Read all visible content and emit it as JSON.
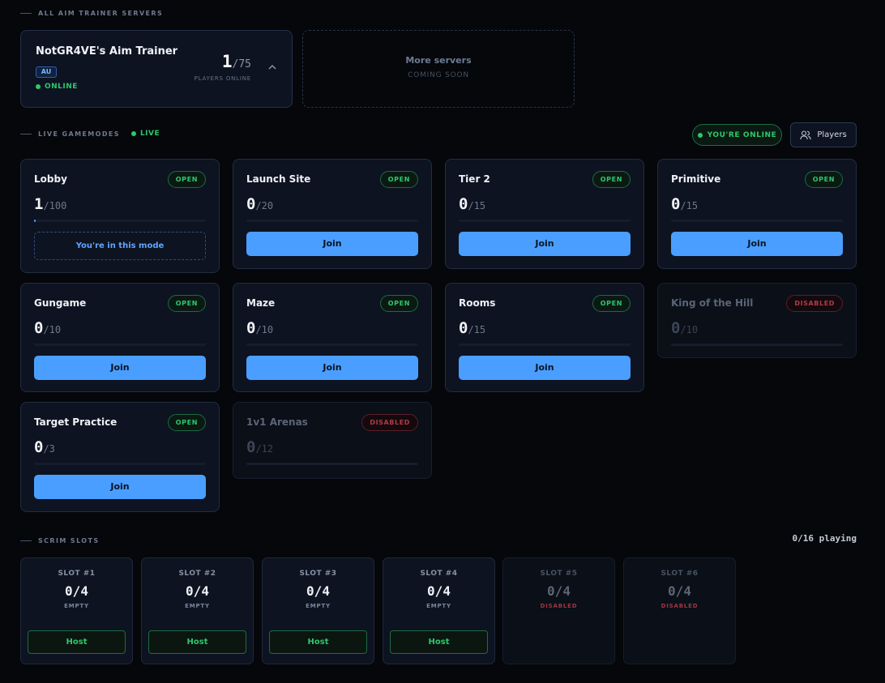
{
  "sections": {
    "servers_label": "ALL AIM TRAINER SERVERS",
    "gamemodes_label": "LIVE GAMEMODES",
    "live_tag": "LIVE",
    "scrim_label": "SCRIM SLOTS"
  },
  "server": {
    "name": "NotGR4VE's Aim Trainer",
    "region": "AU",
    "status": "ONLINE",
    "players": "1",
    "capacity": "/75",
    "players_label": "PLAYERS ONLINE"
  },
  "more_servers": {
    "title": "More servers",
    "subtitle": "COMING SOON"
  },
  "header_actions": {
    "online_status": "YOU'RE ONLINE",
    "players_button": "Players"
  },
  "modes": [
    {
      "name": "Lobby",
      "badge": "OPEN",
      "count": "1",
      "max": "/100",
      "progress": 0.01,
      "action": "You're in this mode"
    },
    {
      "name": "Launch Site",
      "badge": "OPEN",
      "count": "0",
      "max": "/20",
      "progress": 0,
      "action": "Join"
    },
    {
      "name": "Tier 2",
      "badge": "OPEN",
      "count": "0",
      "max": "/15",
      "progress": 0,
      "action": "Join"
    },
    {
      "name": "Primitive",
      "badge": "OPEN",
      "count": "0",
      "max": "/15",
      "progress": 0,
      "action": "Join"
    },
    {
      "name": "Gungame",
      "badge": "OPEN",
      "count": "0",
      "max": "/10",
      "progress": 0,
      "action": "Join"
    },
    {
      "name": "Maze",
      "badge": "OPEN",
      "count": "0",
      "max": "/10",
      "progress": 0,
      "action": "Join"
    },
    {
      "name": "Rooms",
      "badge": "OPEN",
      "count": "0",
      "max": "/15",
      "progress": 0,
      "action": "Join"
    },
    {
      "name": "King of the Hill",
      "badge": "DISABLED",
      "count": "0",
      "max": "/10",
      "progress": 0
    },
    {
      "name": "Target Practice",
      "badge": "OPEN",
      "count": "0",
      "max": "/3",
      "progress": 0,
      "action": "Join"
    },
    {
      "name": "1v1 Arenas",
      "badge": "DISABLED",
      "count": "0",
      "max": "/12",
      "progress": 0
    }
  ],
  "scrim": {
    "playing": "0/16 playing",
    "slots": [
      {
        "title": "SLOT #1",
        "count": "0/4",
        "state": "EMPTY",
        "action": "Host"
      },
      {
        "title": "SLOT #2",
        "count": "0/4",
        "state": "EMPTY",
        "action": "Host"
      },
      {
        "title": "SLOT #3",
        "count": "0/4",
        "state": "EMPTY",
        "action": "Host"
      },
      {
        "title": "SLOT #4",
        "count": "0/4",
        "state": "EMPTY",
        "action": "Host"
      },
      {
        "title": "SLOT #5",
        "count": "0/4",
        "state": "DISABLED"
      },
      {
        "title": "SLOT #6",
        "count": "0/4",
        "state": "DISABLED"
      }
    ]
  },
  "colors": {
    "accent": "#4a9eff",
    "online": "#2fc76b",
    "disabled": "#b03a4a",
    "background": "#05070b"
  }
}
